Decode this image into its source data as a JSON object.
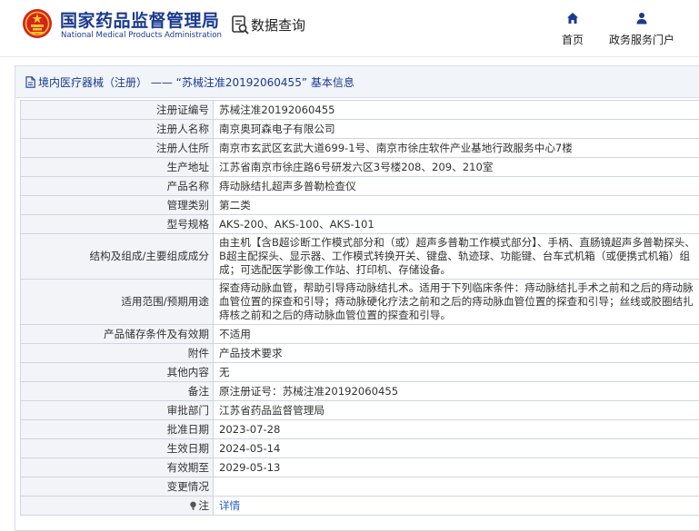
{
  "header": {
    "brand_cn": "国家药品监督管理局",
    "brand_en": "National Medical Products Administration",
    "query_label": "数据查询",
    "nav": {
      "home": "首页",
      "services": "政务服务门户"
    },
    "accent_color": "#1a3a8f"
  },
  "panel": {
    "title": "境内医疗器械（注册） —— “苏械注准20192060455” 基本信息"
  },
  "rows": [
    {
      "key": "注册证编号",
      "value": "苏械注准20192060455"
    },
    {
      "key": "注册人名称",
      "value": "南京奥珂森电子有限公司"
    },
    {
      "key": "注册人住所",
      "value": "南京市玄武区玄武大道699-1号、南京市徐庄软件产业基地行政服务中心7楼"
    },
    {
      "key": "生产地址",
      "value": "江苏省南京市徐庄路6号研发六区3号楼208、209、210室"
    },
    {
      "key": "产品名称",
      "value": "痔动脉结扎超声多普勒检查仪"
    },
    {
      "key": "管理类别",
      "value": "第二类"
    },
    {
      "key": "型号规格",
      "value": "AKS-200、AKS-100、AKS-101"
    },
    {
      "key": "结构及组成/主要组成成分",
      "value": "由主机【含B超诊断工作模式部分和（或）超声多普勒工作模式部分】、手柄、直肠镜超声多普勒探头、B超主配探头、显示器、工作模式转换开关、键盘、轨迹球、功能键、台车式机箱（或便携式机箱）组成；可选配医学影像工作站、打印机、存储设备。"
    },
    {
      "key": "适用范围/预期用途",
      "value": "探查痔动脉血管，帮助引导痔动脉结扎术。适用于下列临床条件：痔动脉结扎手术之前和之后的痔动脉血管位置的探查和引导；痔动脉硬化疗法之前和之后的痔动脉血管位置的探查和引导；丝线或胶圈结扎痔核之前和之后的痔动脉血管位置的探查和引导。"
    },
    {
      "key": "产品储存条件及有效期",
      "value": "不适用"
    },
    {
      "key": "附件",
      "value": "产品技术要求"
    },
    {
      "key": "其他内容",
      "value": "无"
    },
    {
      "key": "备注",
      "value": "原注册证号：苏械注准20192060455"
    },
    {
      "key": "审批部门",
      "value": "江苏省药品监督管理局"
    },
    {
      "key": "批准日期",
      "value": "2023-07-28"
    },
    {
      "key": "生效日期",
      "value": "2024-05-14"
    },
    {
      "key": "有效期至",
      "value": "2029-05-13"
    },
    {
      "key": "变更情况",
      "value": ""
    },
    {
      "key": "注",
      "value": "详情",
      "icon": "note-icon",
      "link": true
    }
  ]
}
